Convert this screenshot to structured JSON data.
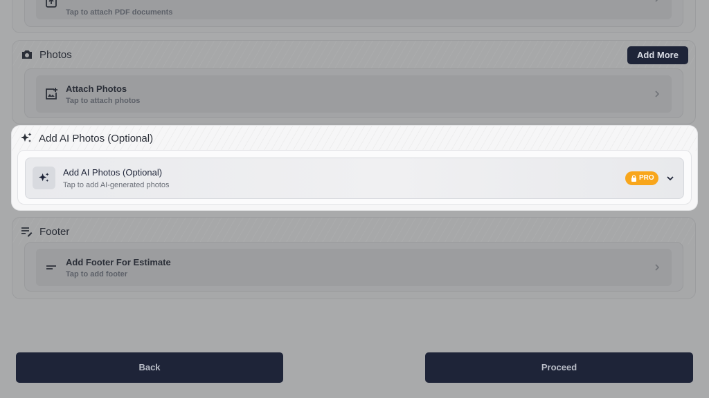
{
  "pdf_section": {
    "row_subtitle": "Tap to attach PDF documents",
    "icon": "upload-file-icon"
  },
  "photos_section": {
    "title": "Photos",
    "title_icon": "camera-icon",
    "add_more_label": "Add More",
    "row_title": "Attach Photos",
    "row_subtitle": "Tap to attach photos",
    "row_icon": "add-photo-icon"
  },
  "ai_section": {
    "title": "Add AI Photos (Optional)",
    "title_icon": "sparkles-icon",
    "row_title": "Add AI Photos (Optional)",
    "row_subtitle": "Tap to add AI-generated photos",
    "badge_label": "PRO",
    "badge_color": "#f8a61c"
  },
  "footer_section": {
    "title": "Footer",
    "title_icon": "notes-edit-icon",
    "row_title": "Add Footer For Estimate",
    "row_subtitle": "Tap to add footer",
    "row_icon": "text-lines-icon"
  },
  "actions": {
    "back_label": "Back",
    "proceed_label": "Proceed",
    "button_color": "#1e2438"
  }
}
